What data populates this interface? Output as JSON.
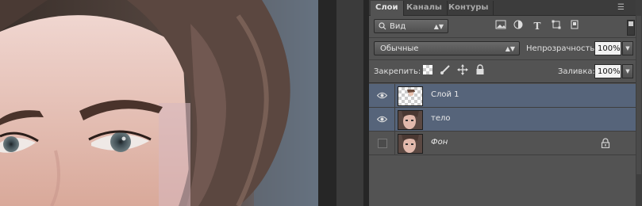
{
  "panel": {
    "tabs": [
      {
        "label": "Слои",
        "active": true
      },
      {
        "label": "Каналы",
        "active": false
      },
      {
        "label": "Контуры",
        "active": false
      }
    ],
    "menu_icon": "panel-menu-icon",
    "filter": {
      "icon": "search-icon",
      "value": "Вид"
    },
    "filter_icons": [
      "image-filter-icon",
      "adjustment-filter-icon",
      "type-filter-icon",
      "shape-filter-icon",
      "smart-object-filter-icon"
    ],
    "blend_mode": "Обычные",
    "opacity_label": "Непрозрачность:",
    "opacity_value": "100%",
    "lock_label": "Закрепить:",
    "lock_icons": [
      "lock-transparency-icon",
      "lock-brush-icon",
      "lock-position-icon",
      "lock-all-icon"
    ],
    "fill_label": "Заливка:",
    "fill_value": "100%",
    "layers": [
      {
        "name": "Слой 1",
        "visible": true,
        "selected": true,
        "italic": false,
        "locked": false
      },
      {
        "name": "тело",
        "visible": true,
        "selected": true,
        "italic": false,
        "locked": false
      },
      {
        "name": "Фон",
        "visible": false,
        "selected": false,
        "italic": true,
        "locked": true
      }
    ]
  },
  "colors": {
    "panel_bg": "#535353",
    "selected_layer": "#56647a",
    "tab_bar": "#3c3c3c"
  }
}
